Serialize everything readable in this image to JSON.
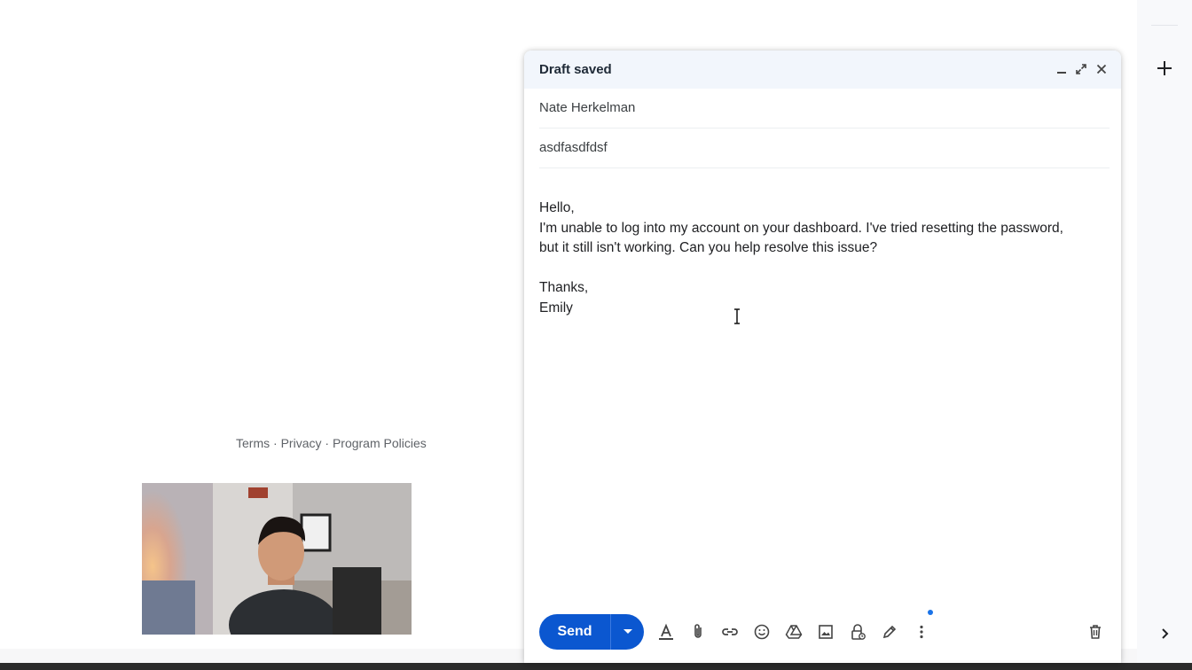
{
  "compose": {
    "title": "Draft saved",
    "to": "Nate Herkelman",
    "subject": "asdfasdfdsf",
    "body": {
      "greeting": "Hello,",
      "line1": "I'm unable to log into my account on your dashboard. I've tried resetting the password,",
      "line2": "but it still isn't working. Can you help resolve this issue?",
      "closing": "Thanks,",
      "signature": "Emily"
    },
    "toolbar": {
      "send_label": "Send",
      "icons": [
        "text-format-icon",
        "attach-icon",
        "link-icon",
        "emoji-icon",
        "drive-icon",
        "image-icon",
        "confidential-icon",
        "signature-icon",
        "more-options-icon",
        "delete-icon"
      ]
    }
  },
  "footer": {
    "terms": "Terms",
    "sep1": " · ",
    "privacy": "Privacy",
    "sep2": " · ",
    "policies": "Program Policies"
  },
  "colors": {
    "accent": "#0b57d0",
    "header_bg": "#f2f6fc"
  }
}
